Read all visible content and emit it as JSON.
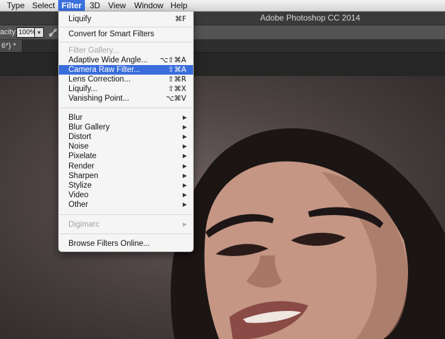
{
  "menubar": {
    "items": [
      "Type",
      "Select",
      "Filter",
      "3D",
      "View",
      "Window",
      "Help"
    ],
    "active": "Filter"
  },
  "app_title": "Adobe Photoshop CC 2014",
  "options": {
    "opacity_label": "acity:",
    "opacity_value": "100%",
    "opacity_arrow": "▾"
  },
  "document_tab": "6*) *",
  "filter_menu": {
    "last_filter": {
      "label": "Liquify",
      "shortcut": "⌘F"
    },
    "convert": "Convert for Smart Filters",
    "filter_gallery": "Filter Gallery...",
    "adaptive_wide_angle": {
      "label": "Adaptive Wide Angle...",
      "shortcut": "⌥⇧⌘A"
    },
    "camera_raw": {
      "label": "Camera Raw Filter...",
      "shortcut": "⇧⌘A"
    },
    "lens_correction": {
      "label": "Lens Correction...",
      "shortcut": "⇧⌘R"
    },
    "liquify": {
      "label": "Liquify...",
      "shortcut": "⇧⌘X"
    },
    "vanishing_point": {
      "label": "Vanishing Point...",
      "shortcut": "⌥⌘V"
    },
    "submenus": [
      "Blur",
      "Blur Gallery",
      "Distort",
      "Noise",
      "Pixelate",
      "Render",
      "Sharpen",
      "Stylize",
      "Video",
      "Other"
    ],
    "digimarc": "Digimarc",
    "browse_online": "Browse Filters Online...",
    "submenu_arrow": "▶"
  },
  "colors": {
    "menu_highlight": "#3a6ddc",
    "menubar_active": "#3b6fdd"
  }
}
